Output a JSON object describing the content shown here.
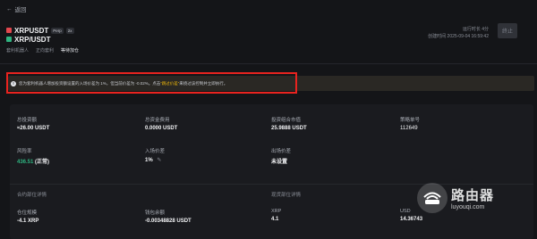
{
  "nav": {
    "back_label": "返回"
  },
  "pair": {
    "symbol": "XRPUSDT",
    "tag_perp": "Perp",
    "tag_lev": "2x",
    "spot_symbol": "XRP/USDT",
    "strategy": "套利机器人",
    "direction": "正向套利",
    "status": "等待加仓"
  },
  "run_info": {
    "runtime": "运行时长 4分",
    "created": "创建时间 2025-09-04 16:59:42"
  },
  "stop_button": "终止",
  "alert": {
    "text_before": "您为套利机器人增加投资额设置的入场价差为 1%，但当前价差为 -0.02%。点击",
    "link": "“跳过价差”",
    "text_after": "来绕过该控制并立即执行。"
  },
  "stats": {
    "total_invest_label": "总投资额",
    "total_invest_value": "≈26.00 USDT",
    "total_fee_label": "总资金费用",
    "total_fee_value": "0.0000 USDT",
    "portfolio_label": "投资组合市值",
    "portfolio_value": "25.9888 USDT",
    "strategy_id_label": "策略单号",
    "strategy_id_value": "112649",
    "risk_label": "风险率",
    "risk_value": "436.51",
    "risk_status": "(正常)",
    "entry_spread_label": "入场价差",
    "entry_spread_value": "1%",
    "exit_spread_label": "出场价差",
    "exit_spread_value": "未设置"
  },
  "contract": {
    "title": "合约部位详情",
    "size_label": "仓位规模",
    "size_value": "-4.1 XRP",
    "wallet_label": "钱包余额",
    "wallet_value": "-0.00348828 USDT"
  },
  "spot": {
    "title": "现货部位详情",
    "xrp_label": "XRP",
    "xrp_value": "4.1",
    "usdt_label": "USD",
    "usdt_value": "14.36743"
  },
  "watermark": {
    "big": "路由器",
    "small": "luyouqi.com"
  }
}
